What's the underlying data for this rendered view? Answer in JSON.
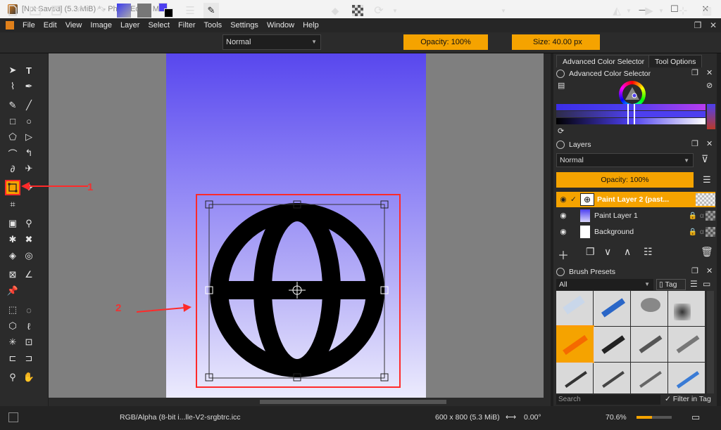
{
  "window": {
    "title": "[Not Saved]  (5.3 MiB) * - Photo Editor Max",
    "controls": [
      "—",
      "☐",
      "✕"
    ]
  },
  "menu": [
    "File",
    "Edit",
    "View",
    "Image",
    "Layer",
    "Select",
    "Filter",
    "Tools",
    "Settings",
    "Window",
    "Help"
  ],
  "toolbar": {
    "blend_mode": "Normal",
    "opacity": "Opacity: 100%",
    "size": "Size: 40.00 px"
  },
  "dock_tabs": [
    "Advanced Color Selector",
    "Tool Options"
  ],
  "color_selector": {
    "title": "Advanced Color Selector"
  },
  "layers": {
    "title": "Layers",
    "blend_mode": "Normal",
    "opacity": "Opacity: 100%",
    "items": [
      {
        "name": "Paint Layer 2 (past...",
        "active": true
      },
      {
        "name": "Paint Layer 1",
        "active": false
      },
      {
        "name": "Background",
        "active": false
      }
    ]
  },
  "brush_presets": {
    "title": "Brush Presets",
    "filter": "All",
    "tag_label": "Tag",
    "search_placeholder": "Search",
    "filter_in_tag": "Filter in Tag"
  },
  "status": {
    "color_profile": "RGB/Alpha (8-bit i...lle-V2-srgbtrc.icc",
    "image_size": "600 x 800 (5.3 MiB)",
    "rotation": "0.00°",
    "zoom": "70.6%"
  },
  "annotations": {
    "one": "1",
    "two": "2"
  },
  "colors": {
    "accent": "#f5a300",
    "annotation": "#ff2a2a"
  }
}
